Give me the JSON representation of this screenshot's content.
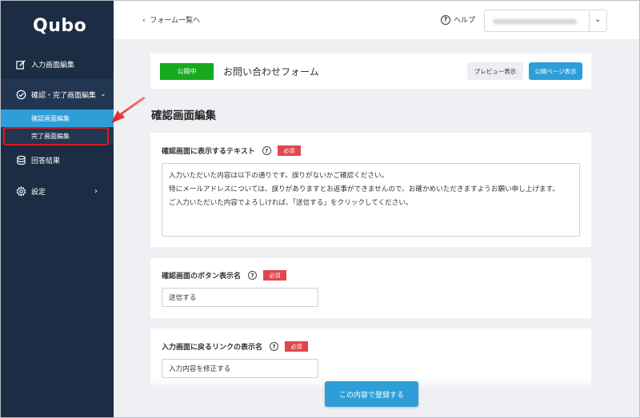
{
  "sidebar": {
    "logo": "Qubo",
    "items": [
      {
        "label": "入力画面編集",
        "icon": "edit-icon"
      },
      {
        "label": "確認・完了画面編集",
        "icon": "check-circle-icon"
      },
      {
        "label": "回答結果",
        "icon": "database-icon"
      },
      {
        "label": "設定",
        "icon": "gear-icon"
      }
    ],
    "subitems": [
      {
        "label": "確認画面編集"
      },
      {
        "label": "完了画面編集"
      }
    ]
  },
  "header": {
    "back_label": "フォーム一覧へ",
    "help_label": "ヘルプ"
  },
  "form": {
    "status": "公開中",
    "title": "お問い合わせフォーム",
    "preview_label": "プレビュー表示",
    "public_label": "公開ページ表示"
  },
  "section_title": "確認画面編集",
  "fields": {
    "confirm_text": {
      "label": "確認画面に表示するテキスト",
      "required": "必須",
      "value": "入力いただいた内容は以下の通りです。誤りがないかご確認ください。\n特にメールアドレスについては、誤りがありますとお返事ができませんので、お確かめいただきますようお願い申し上げます。\nご入力いただいた内容でよろしければ、「送信する」をクリックしてください。"
    },
    "button_name": {
      "label": "確認画面のボタン表示名",
      "required": "必須",
      "value": "送信する"
    },
    "back_link": {
      "label": "入力画面に戻るリンクの表示名",
      "required": "必須",
      "value": "入力内容を修正する"
    }
  },
  "submit_label": "この内容で登録する",
  "colors": {
    "sidebar_bg": "#1b2c44",
    "accent": "#2d9ed8",
    "published": "#17a91f",
    "required": "#e0474c",
    "highlight": "#e0191e"
  }
}
